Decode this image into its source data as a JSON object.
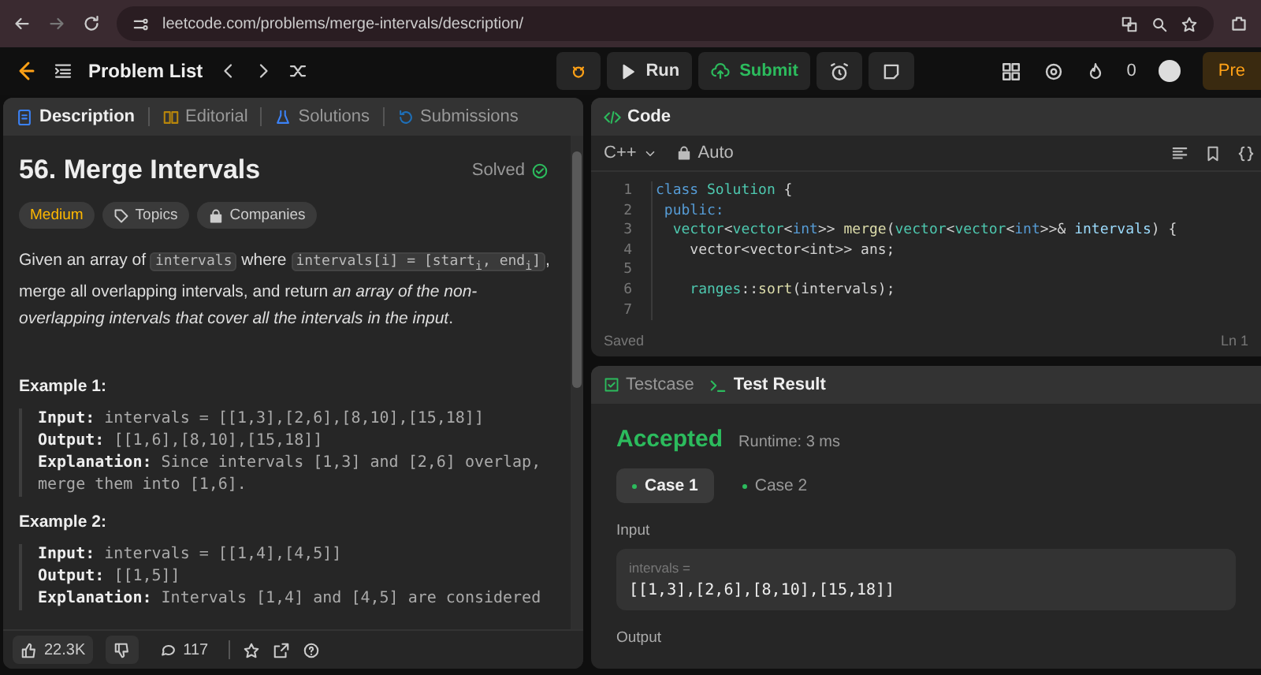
{
  "browser": {
    "url": "leetcode.com/problems/merge-intervals/description/"
  },
  "nav": {
    "problem_list": "Problem List",
    "run": "Run",
    "submit": "Submit",
    "coins": "0",
    "premium": "Pre"
  },
  "left_tabs": [
    {
      "label": "Description",
      "selected": true
    },
    {
      "label": "Editorial",
      "selected": false
    },
    {
      "label": "Solutions",
      "selected": false
    },
    {
      "label": "Submissions",
      "selected": false
    }
  ],
  "problem": {
    "title": "56. Merge Intervals",
    "status": "Solved",
    "solved": true,
    "tags": [
      {
        "kind": "difficulty",
        "label": "Medium"
      },
      {
        "kind": "topics",
        "label": "Topics"
      },
      {
        "kind": "companies",
        "label": "Companies"
      }
    ],
    "description": [
      {
        "kind": "text",
        "text": "Given an array of "
      },
      {
        "kind": "code",
        "text": "intervals"
      },
      {
        "kind": "text",
        "text": " where "
      },
      {
        "kind": "code",
        "text": "intervals[i] = [start$_{i}$, end$_{i}$]"
      },
      {
        "kind": "text",
        "text": ", merge all overlapping intervals, and return "
      },
      {
        "kind": "italic",
        "text": "an array of the non-overlapping intervals that cover all the intervals in the input"
      },
      {
        "kind": "text",
        "text": "."
      }
    ],
    "examples": [
      {
        "title": "Example 1:",
        "lines": [
          {
            "label": "Input:",
            "text": "intervals = [[1,3],[2,6],[8,10],[15,18]]"
          },
          {
            "label": "Output:",
            "text": "[[1,6],[8,10],[15,18]]"
          },
          {
            "label": "Explanation:",
            "text": "Since intervals [1,3] and [2,6] overlap, merge them into [1,6]."
          }
        ]
      },
      {
        "title": "Example 2:",
        "lines": [
          {
            "label": "Input:",
            "text": "intervals = [[1,4],[4,5]]"
          },
          {
            "label": "Output:",
            "text": "[[1,5]]"
          },
          {
            "label": "Explanation:",
            "text": "Intervals [1,4] and [4,5] are considered"
          }
        ]
      }
    ]
  },
  "footer": {
    "likes": "22.3K",
    "comments": "117"
  },
  "code": {
    "title": "Code",
    "language": "C++",
    "mode": "Auto",
    "status": "Saved",
    "cursor": "Ln 1",
    "lines": [
      {
        "number": "1",
        "tokens": [
          {
            "kind": "keyword",
            "text": "class "
          },
          {
            "kind": "type",
            "text": "Solution"
          },
          {
            "kind": "plain",
            "text": " {"
          }
        ]
      },
      {
        "number": "2",
        "tokens": [
          {
            "kind": "keyword",
            "text": " public:"
          }
        ]
      },
      {
        "number": "3",
        "tokens": [
          {
            "kind": "type",
            "text": "  vector"
          },
          {
            "kind": "plain",
            "text": "<"
          },
          {
            "kind": "type",
            "text": "vector"
          },
          {
            "kind": "plain",
            "text": "<"
          },
          {
            "kind": "keyword",
            "text": "int"
          },
          {
            "kind": "plain",
            "text": ">> "
          },
          {
            "kind": "function",
            "text": "merge"
          },
          {
            "kind": "plain",
            "text": "("
          },
          {
            "kind": "type",
            "text": "vector"
          },
          {
            "kind": "plain",
            "text": "<"
          },
          {
            "kind": "type",
            "text": "vector"
          },
          {
            "kind": "plain",
            "text": "<"
          },
          {
            "kind": "keyword",
            "text": "int"
          },
          {
            "kind": "plain",
            "text": ">>& "
          },
          {
            "kind": "param",
            "text": "intervals"
          },
          {
            "kind": "plain",
            "text": ") {"
          }
        ]
      },
      {
        "number": "4",
        "tokens": [
          {
            "kind": "plain",
            "text": "    vector<vector<int>> ans;"
          }
        ]
      },
      {
        "number": "5"
      },
      {
        "number": "6",
        "tokens": [
          {
            "kind": "type",
            "text": "    ranges"
          },
          {
            "kind": "plain",
            "text": "::"
          },
          {
            "kind": "function",
            "text": "sort"
          },
          {
            "kind": "plain",
            "text": "(intervals);"
          }
        ]
      },
      {
        "number": "7"
      }
    ]
  },
  "test": {
    "tabs": [
      {
        "label": "Testcase",
        "selected": false
      },
      {
        "label": "Test Result",
        "selected": true
      }
    ],
    "verdict": "Accepted",
    "runtime": "Runtime: 3 ms",
    "cases": [
      {
        "label": "Case 1",
        "selected": true
      },
      {
        "label": "Case 2",
        "selected": false
      }
    ],
    "input_label": "Input",
    "param": "intervals =",
    "value": "[[1,3],[2,6],[8,10],[15,18]]",
    "output_label": "Output"
  }
}
